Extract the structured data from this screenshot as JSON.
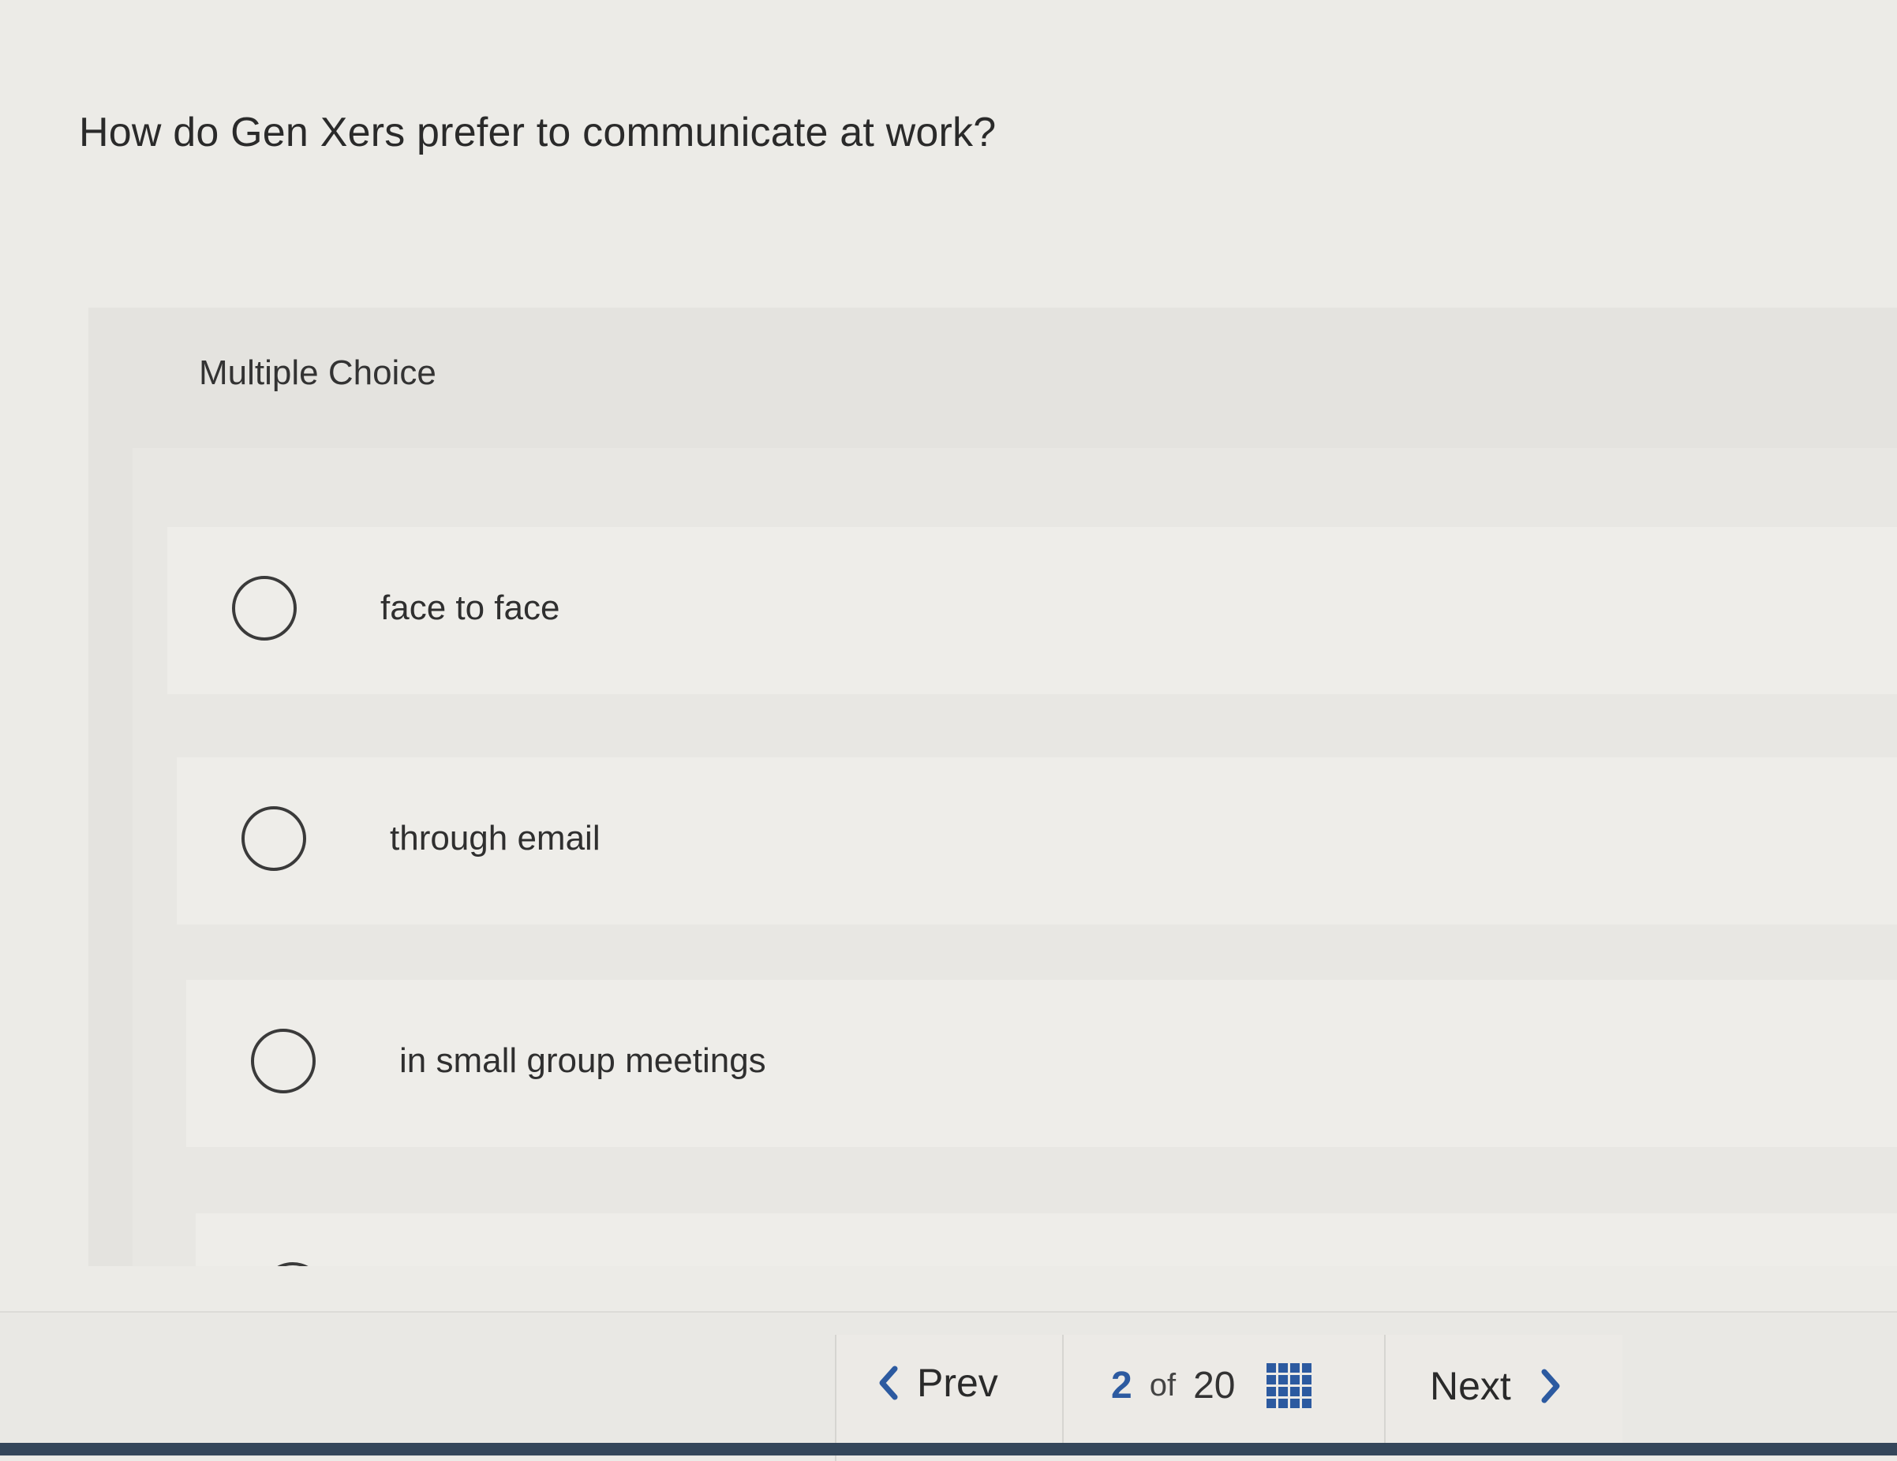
{
  "question": {
    "text": "How do Gen Xers prefer to communicate at work?"
  },
  "panel": {
    "type_label": "Multiple Choice",
    "options": [
      {
        "label": "face to face",
        "selected": false
      },
      {
        "label": "through email",
        "selected": false
      },
      {
        "label": "in small group meetings",
        "selected": false
      },
      {
        "label": "",
        "selected": false
      }
    ]
  },
  "footer": {
    "prev_label": "Prev",
    "next_label": "Next",
    "current_page": "2",
    "of_label": "of",
    "total_pages": "20",
    "icons": {
      "prev": "chevron-left-icon",
      "next": "chevron-right-icon",
      "overview": "grid-icon"
    }
  },
  "colors": {
    "accent": "#2c5aa0",
    "background": "#ecebe7",
    "panel": "#e4e3df",
    "bottom_strip": "#34465a"
  }
}
